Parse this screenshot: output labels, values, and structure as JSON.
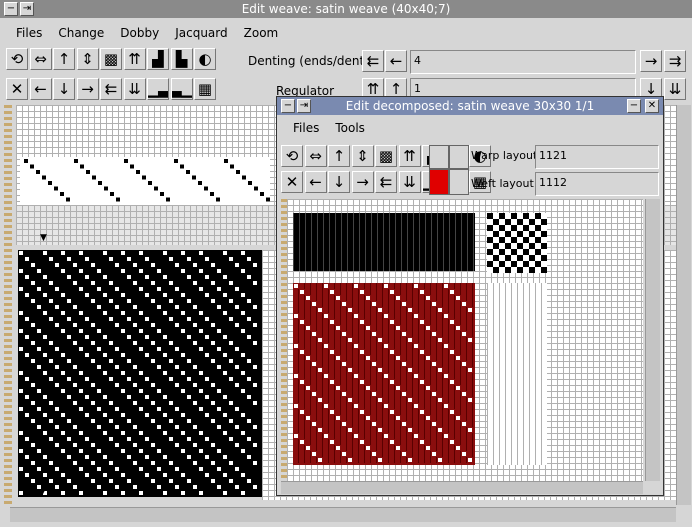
{
  "main_window": {
    "title": "Edit weave: satin weave (40x40;7)",
    "menu": [
      "Files",
      "Change",
      "Dobby",
      "Jacquard",
      "Zoom"
    ],
    "toolbar_icons_row1": [
      "rotate-icon",
      "flip-horizontal-icon",
      "arrow-up-icon",
      "flip-vertical-icon",
      "invert-pattern-icon",
      "double-arrow-up-icon",
      "steps-up-icon",
      "steps-down-icon",
      "half-fill-icon"
    ],
    "toolbar_glyphs_row1": [
      "⟲",
      "⇔",
      "↑",
      "⇕",
      "▩",
      "⇈",
      "▟",
      "▙",
      "◐"
    ],
    "toolbar_icons_row2": [
      "clear-icon",
      "arrow-left-icon",
      "arrow-down-icon",
      "arrow-right-icon",
      "double-arrow-left-icon",
      "double-arrow-down-icon",
      "ramp-up-icon",
      "ramp-down-icon",
      "checker-icon"
    ],
    "toolbar_glyphs_row2": [
      "✕",
      "←",
      "↓",
      "→",
      "⇇",
      "⇊",
      "▁▃",
      "▃▁",
      "▦"
    ],
    "denting_label": "Denting (ends/dent)",
    "denting_value": "4",
    "regulator_label": "Regulator",
    "regulator_value": "1"
  },
  "sub_window": {
    "title": "Edit decomposed: satin weave 30x30 1/1",
    "menu": [
      "Files",
      "Tools"
    ],
    "warp_layout_label": "Warp layout",
    "warp_layout_value": "1121",
    "weft_layout_label": "Weft layout",
    "weft_layout_value": "1112",
    "colors": {
      "warp_color": "#ffffff",
      "weft_color": "#e00000",
      "fabric_red": "#8a0e0e",
      "grid_line": "#a8a8a8"
    }
  }
}
